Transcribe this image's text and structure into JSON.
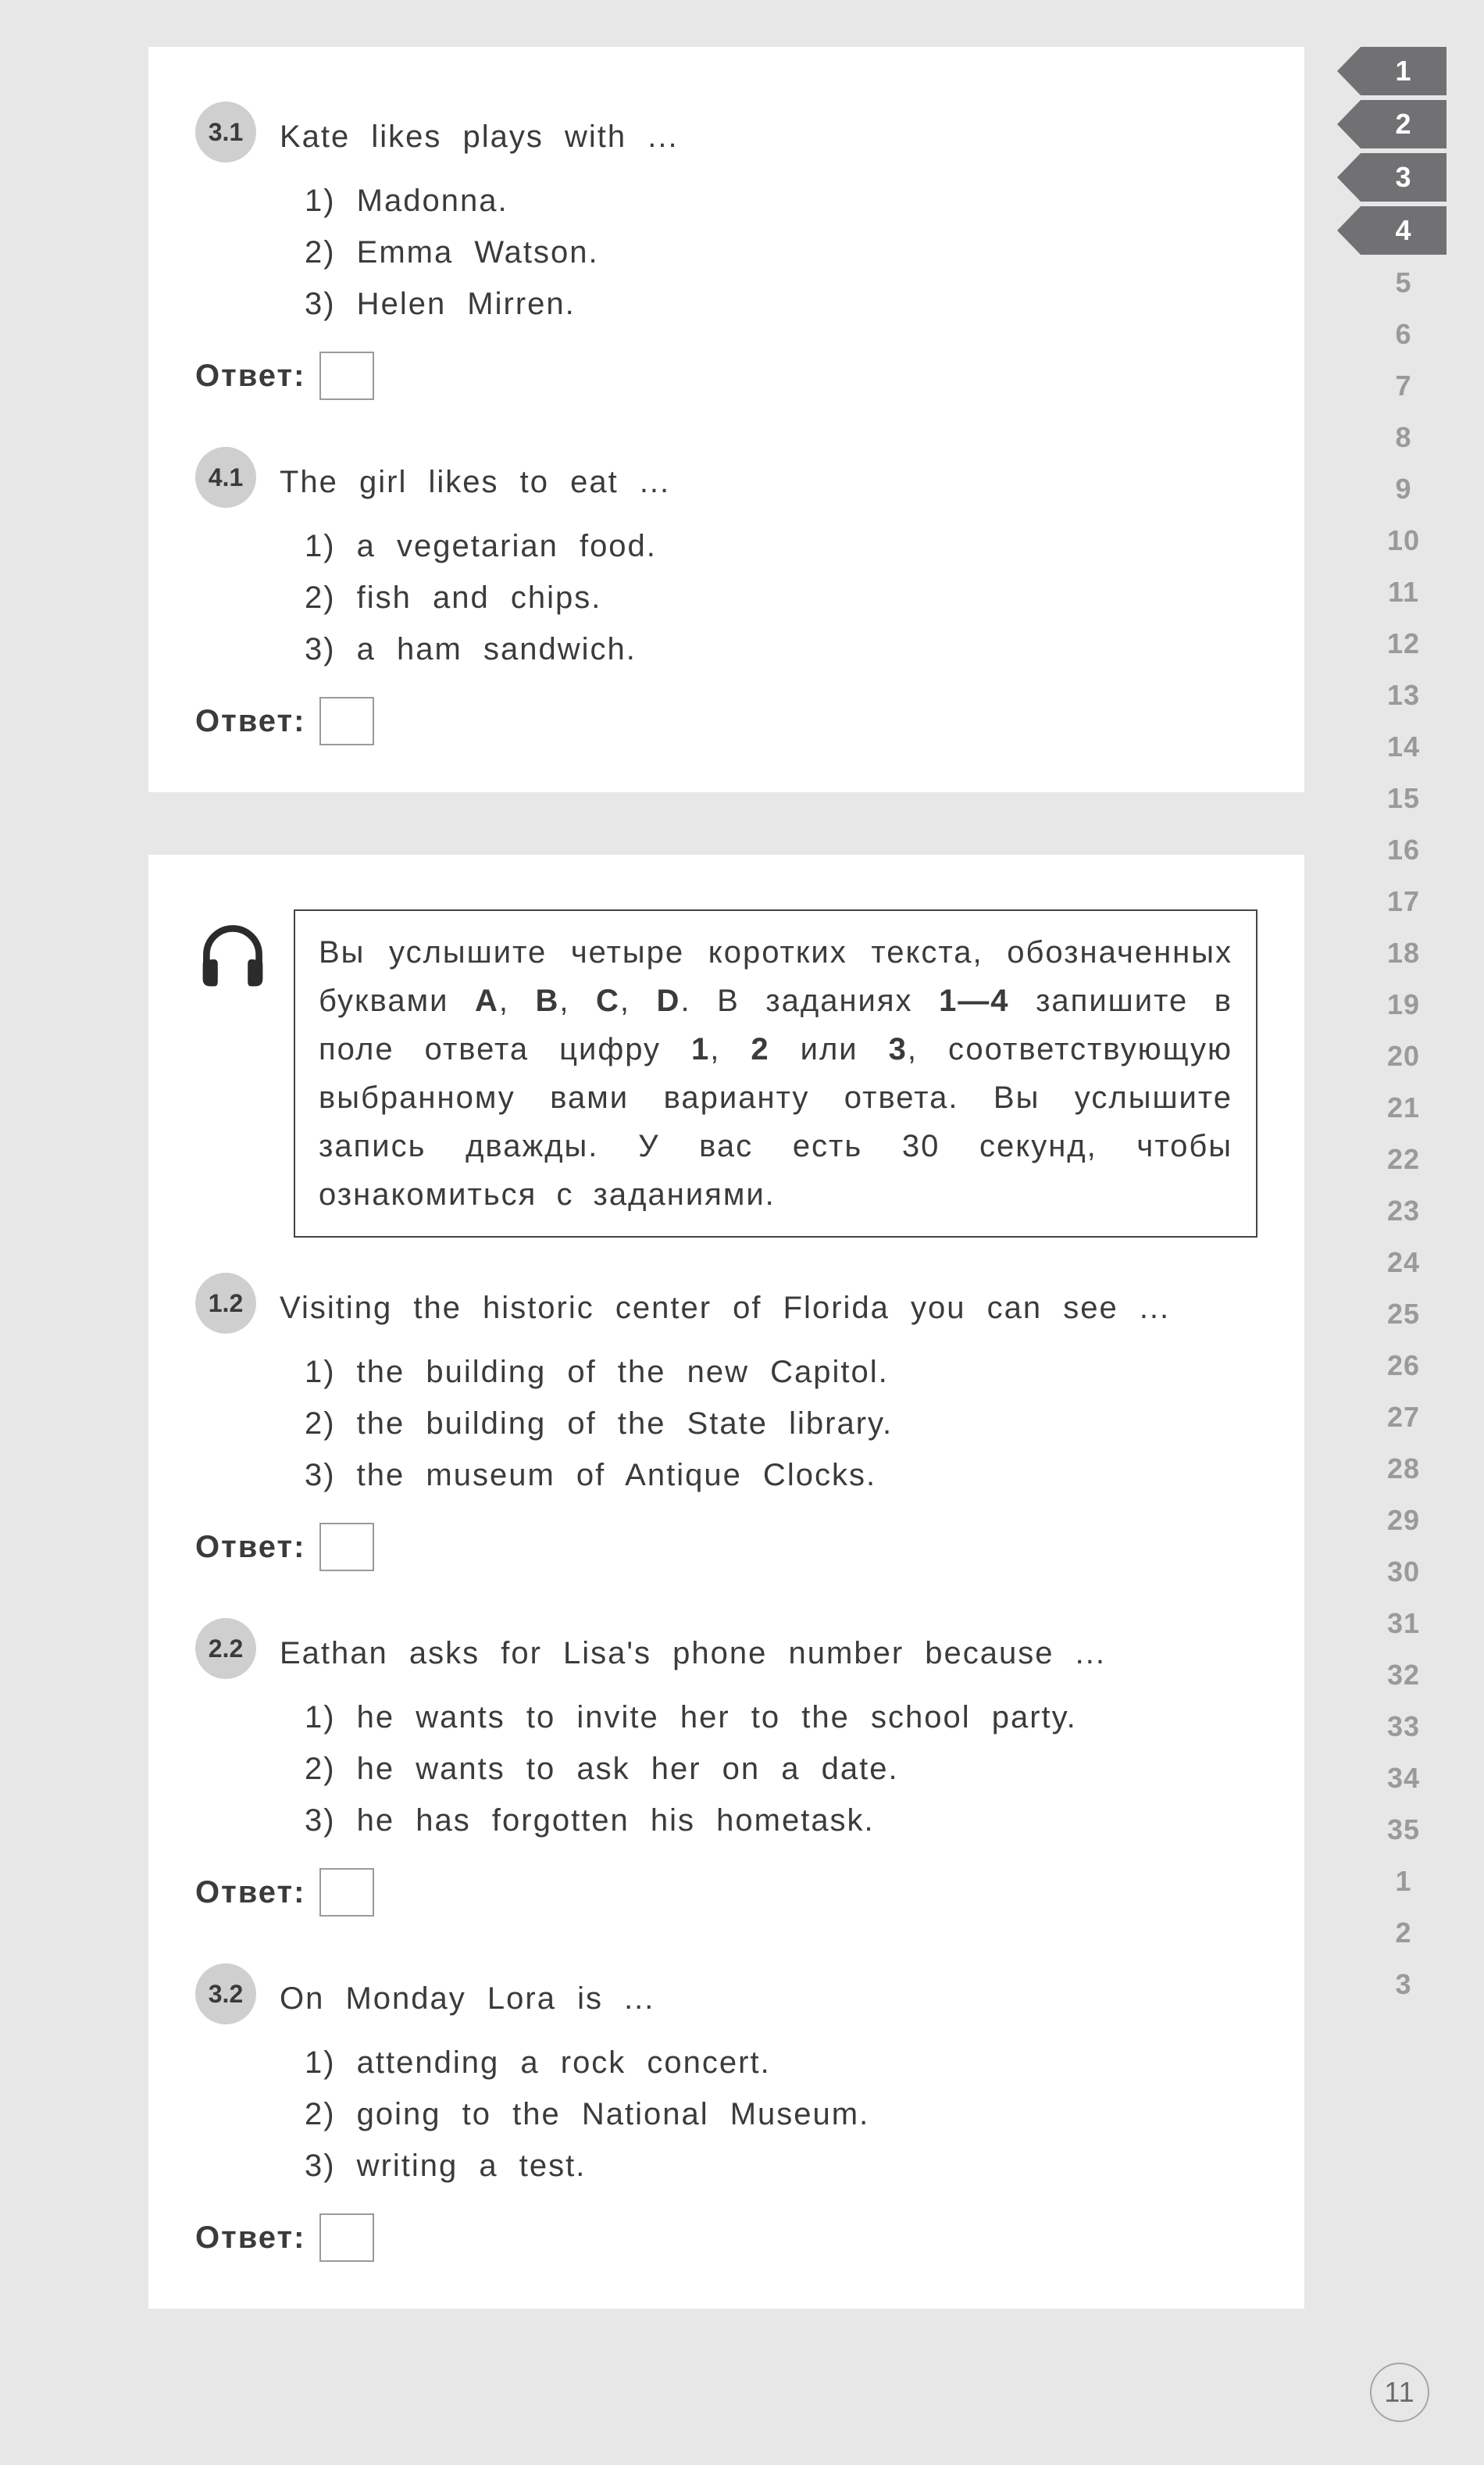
{
  "answer_label": "Ответ:",
  "card1": {
    "q1": {
      "num": "3.1",
      "text": "Kate likes plays with ...",
      "opts": [
        "1)  Madonna.",
        "2)  Emma Watson.",
        "3)  Helen Mirren."
      ]
    },
    "q2": {
      "num": "4.1",
      "text": "The girl likes to eat ...",
      "opts": [
        "1)  a vegetarian food.",
        "2)  fish and chips.",
        "3)  a ham sandwich."
      ]
    }
  },
  "card2": {
    "instructions_parts": [
      "Вы услышите четыре коротких текста, обозначенных буква­ми ",
      "A",
      ", ",
      "B",
      ", ",
      "C",
      ", ",
      "D",
      ". В заданиях ",
      "1—4",
      " запишите в поле ответа цифру ",
      "1",
      ", ",
      "2",
      " или ",
      "3",
      ", соответствующую выбранному вами вари­анту ответа. Вы услышите запись дважды. У вас есть 30 се­кунд, чтобы ознакомиться с заданиями."
    ],
    "q1": {
      "num": "1.2",
      "text": "Visiting the historic center of Florida you can see ...",
      "opts": [
        "1)  the building of the new Capitol.",
        "2)  the building of the State library.",
        "3)  the museum of Antique Clocks."
      ]
    },
    "q2": {
      "num": "2.2",
      "text": "Eathan asks for Lisa's phone number because ...",
      "opts": [
        "1)  he wants to invite her to the school party.",
        "2)  he wants to ask her on a date.",
        "3)  he has forgotten his hometask."
      ]
    },
    "q3": {
      "num": "3.2",
      "text": "On Monday Lora is ...",
      "opts": [
        "1)  attending a rock concert.",
        "2)  going to the National Museum.",
        "3)  writing a test."
      ]
    }
  },
  "side_tabs": {
    "dark": [
      "1",
      "2",
      "3",
      "4"
    ],
    "light": [
      "5",
      "6",
      "7",
      "8",
      "9",
      "10",
      "11",
      "12",
      "13",
      "14",
      "15",
      "16",
      "17",
      "18",
      "19",
      "20",
      "21",
      "22",
      "23",
      "24",
      "25",
      "26",
      "27",
      "28",
      "29",
      "30",
      "31",
      "32",
      "33",
      "34",
      "35",
      "1",
      "2",
      "3"
    ]
  },
  "page_number": "11"
}
